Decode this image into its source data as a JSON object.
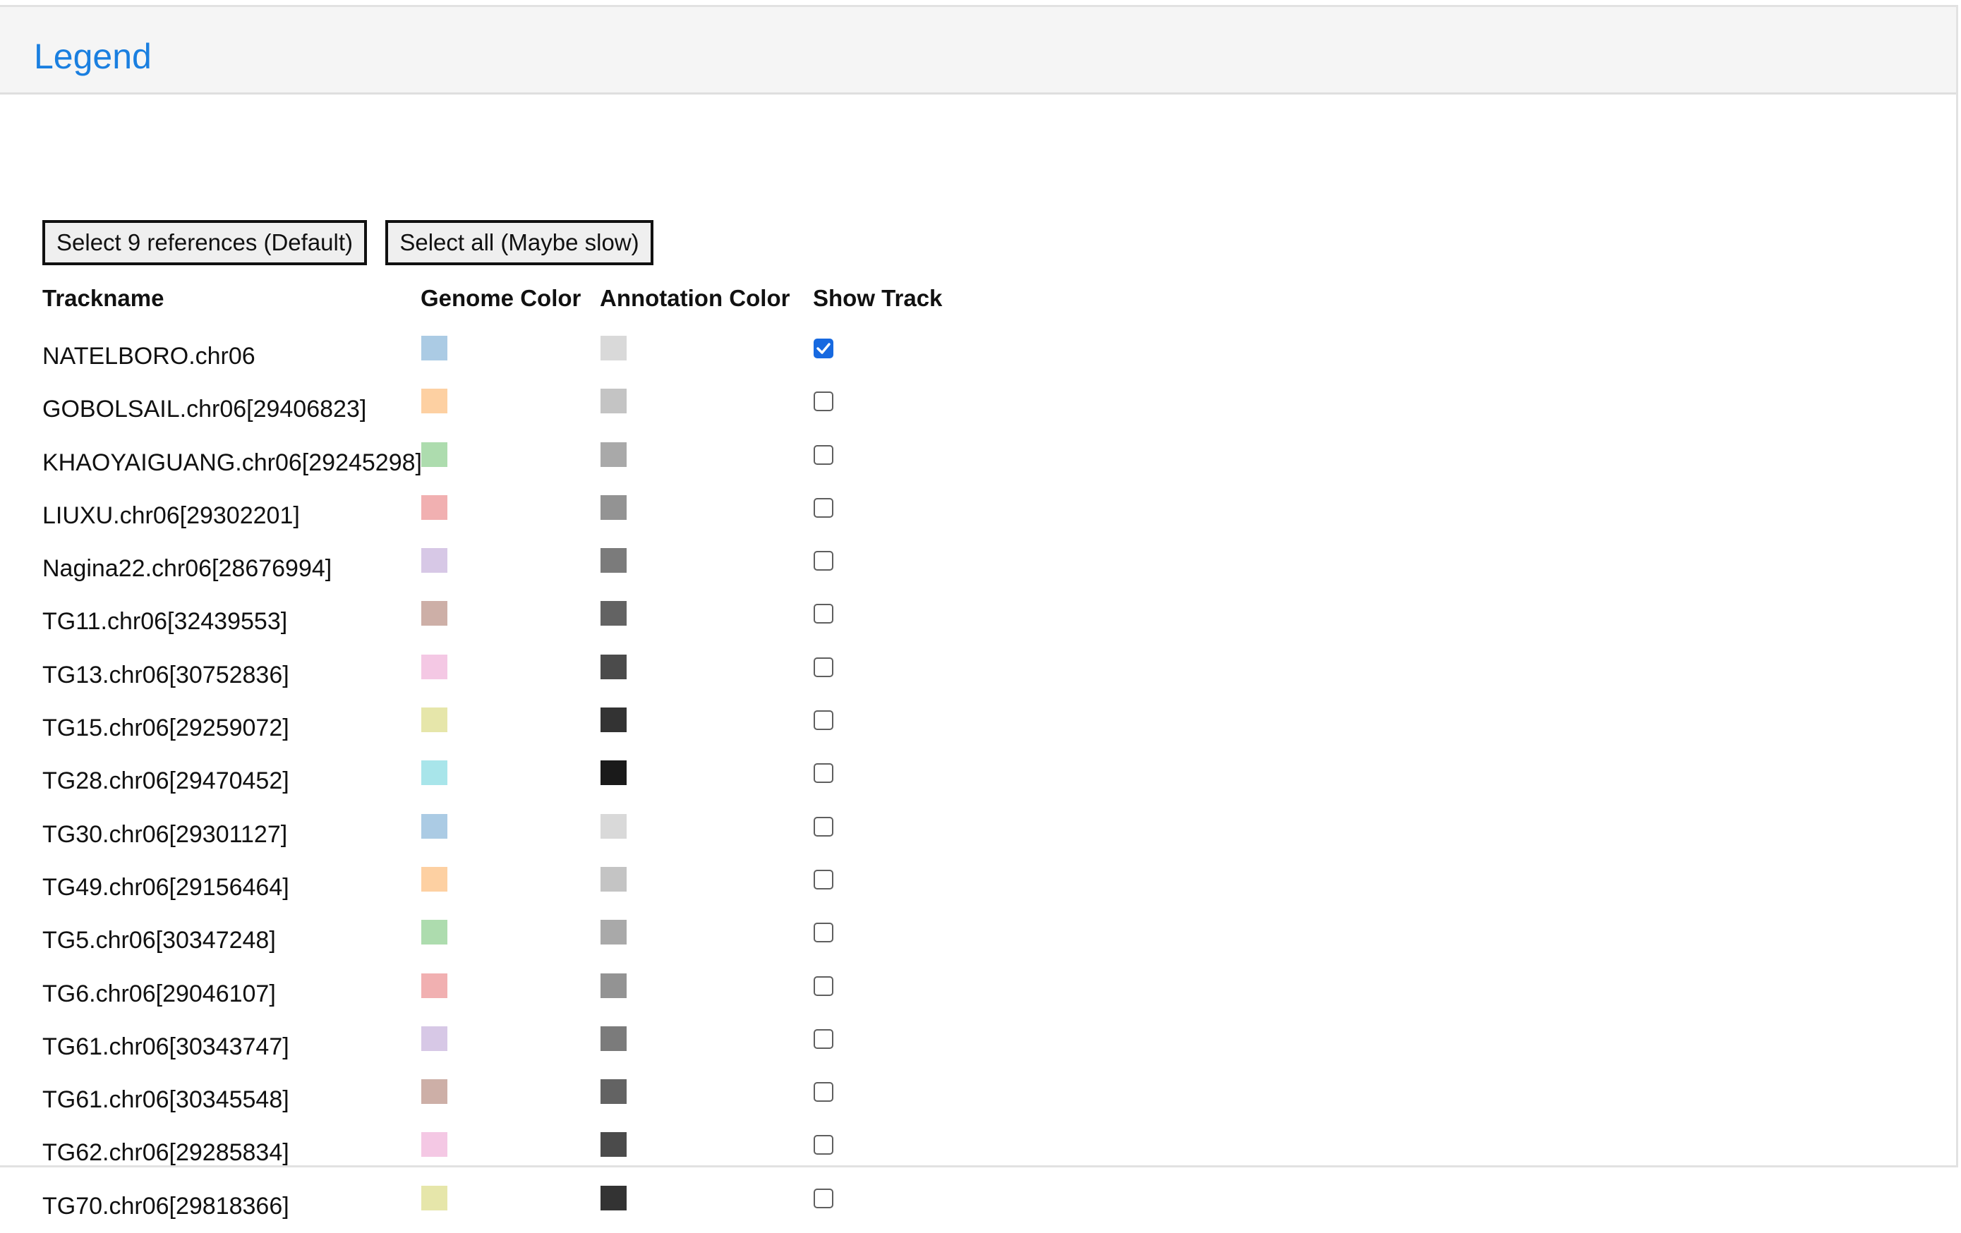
{
  "header": {
    "title": "Legend"
  },
  "buttons": {
    "default_label": "Select 9 references (Default)",
    "all_label": "Select all (Maybe slow)"
  },
  "columns": {
    "trackname": "Trackname",
    "genome_color": "Genome Color",
    "annotation_color": "Annotation Color",
    "show_track": "Show Track"
  },
  "tracks": [
    {
      "name": "NATELBORO.chr06",
      "genome_color": "#abcbe4",
      "annotation_color": "#d9d9d9",
      "show": true
    },
    {
      "name": "GOBOLSAIL.chr06[29406823]",
      "genome_color": "#fdd0a2",
      "annotation_color": "#c4c4c4",
      "show": false
    },
    {
      "name": "KHAOYAIGUANG.chr06[29245298]",
      "genome_color": "#addcae",
      "annotation_color": "#a9a9a9",
      "show": false
    },
    {
      "name": "LIUXU.chr06[29302201]",
      "genome_color": "#f1b0b1",
      "annotation_color": "#939393",
      "show": false
    },
    {
      "name": "Nagina22.chr06[28676994]",
      "genome_color": "#d7c8e6",
      "annotation_color": "#7b7b7b",
      "show": false
    },
    {
      "name": "TG11.chr06[32439553]",
      "genome_color": "#cdafa7",
      "annotation_color": "#636363",
      "show": false
    },
    {
      "name": "TG13.chr06[30752836]",
      "genome_color": "#f4c8e4",
      "annotation_color": "#4b4b4b",
      "show": false
    },
    {
      "name": "TG15.chr06[29259072]",
      "genome_color": "#e6e6aa",
      "annotation_color": "#333333",
      "show": false
    },
    {
      "name": "TG28.chr06[29470452]",
      "genome_color": "#a8e5ea",
      "annotation_color": "#1a1a1a",
      "show": false
    },
    {
      "name": "TG30.chr06[29301127]",
      "genome_color": "#abcbe4",
      "annotation_color": "#d9d9d9",
      "show": false
    },
    {
      "name": "TG49.chr06[29156464]",
      "genome_color": "#fdd0a2",
      "annotation_color": "#c4c4c4",
      "show": false
    },
    {
      "name": "TG5.chr06[30347248]",
      "genome_color": "#addcae",
      "annotation_color": "#a9a9a9",
      "show": false
    },
    {
      "name": "TG6.chr06[29046107]",
      "genome_color": "#f1b0b1",
      "annotation_color": "#939393",
      "show": false
    },
    {
      "name": "TG61.chr06[30343747]",
      "genome_color": "#d7c8e6",
      "annotation_color": "#7b7b7b",
      "show": false
    },
    {
      "name": "TG61.chr06[30345548]",
      "genome_color": "#cdafa7",
      "annotation_color": "#636363",
      "show": false
    },
    {
      "name": "TG62.chr06[29285834]",
      "genome_color": "#f4c8e4",
      "annotation_color": "#4b4b4b",
      "show": false
    },
    {
      "name": "TG70.chr06[29818366]",
      "genome_color": "#e6e6aa",
      "annotation_color": "#333333",
      "show": false
    }
  ]
}
